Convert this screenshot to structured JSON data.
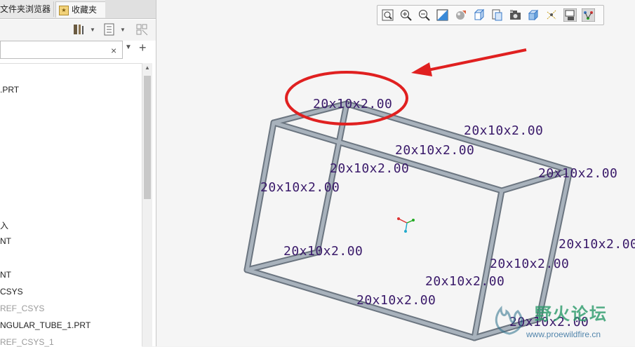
{
  "sidebar": {
    "tabs": [
      {
        "label": "文件夹浏览器"
      },
      {
        "label": "收藏夹"
      }
    ],
    "filter_clear": "×",
    "filter_add": "+",
    "tree_items": [
      {
        "label": ".PRT",
        "dim": false
      },
      {
        "label": "入",
        "dim": false
      },
      {
        "label": "NT",
        "dim": false
      },
      {
        "label": "NT",
        "dim": false
      },
      {
        "label": "CSYS",
        "dim": false
      },
      {
        "label": "REF_CSYS",
        "dim": true
      },
      {
        "label": "NGULAR_TUBE_1.PRT",
        "dim": false
      },
      {
        "label": "REF_CSYS_1",
        "dim": true
      }
    ]
  },
  "viewport": {
    "toolbar_icons": [
      "zoom-fit-icon",
      "zoom-in-icon",
      "zoom-out-icon",
      "repaint-icon",
      "shading-icon",
      "wireframe-icon",
      "saved-views-icon",
      "camera-icon",
      "view-manager-icon",
      "datum-display-icon",
      "annotation-display-icon",
      "spin-center-icon"
    ],
    "dimension_labels": [
      "20x10x2.00",
      "20x10x2.00",
      "20x10x2.00",
      "20x10x2.00",
      "20x10x2.00",
      "20x10x2.00",
      "20x10x2.00",
      "20x10x2.00",
      "20x10x2.00",
      "20x10x2.00",
      "20x10x2.00",
      "20x10x2.00"
    ],
    "highlight_color": "#e02020",
    "label_color": "#3a1a6a",
    "tube_color": "#8e99a3"
  },
  "watermark": {
    "title": "野火论坛",
    "url": "www.proewildfire.cn"
  }
}
